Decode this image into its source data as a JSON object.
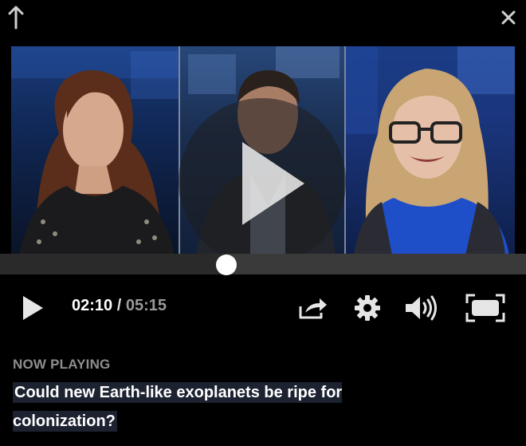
{
  "player": {
    "progress_fraction": 0.43,
    "time": {
      "current": "02:10",
      "separator": "/",
      "duration": "05:15"
    }
  },
  "now_playing": {
    "label": "NOW PLAYING",
    "title": "Could new Earth-like exoplanets be ripe for colonization?"
  },
  "icons": {
    "top_left": "arrow-up-icon",
    "top_right": "close-icon",
    "center": "play-icon",
    "controls": [
      "play-icon",
      "share-icon",
      "gear-icon",
      "volume-icon",
      "fullscreen-icon"
    ]
  },
  "colors": {
    "accent": "#ffffff",
    "muted": "#8e8e8e",
    "title_highlight": "#1c2230"
  }
}
